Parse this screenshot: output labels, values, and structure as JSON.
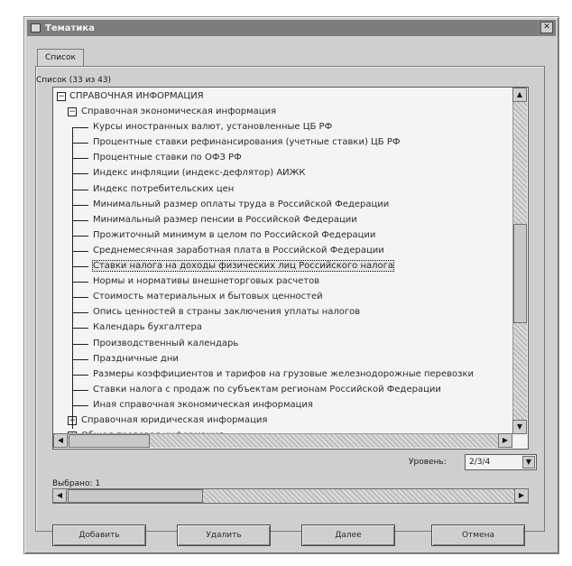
{
  "window": {
    "title": "Тематика",
    "close_glyph": "✕"
  },
  "tab": {
    "label": "Список"
  },
  "tree": {
    "group_label": "Список (33 из 43)",
    "root": {
      "label": "СПРАВОЧНАЯ ИНФОРМАЦИЯ",
      "toggle": "−"
    },
    "child": {
      "label": "Справочная экономическая информация",
      "toggle": "−"
    },
    "items": [
      "Курсы иностранных валют, установленные ЦБ РФ",
      "Процентные ставки рефинансирования (учетные ставки) ЦБ РФ",
      "Процентные ставки по ОФЗ РФ",
      "Индекс инфляции (индекс-дефлятор) АИЖК",
      "Индекс потребительских цен",
      "Минимальный размер оплаты труда в Российской Федерации",
      "Минимальный размер пенсии в Российской Федерации",
      "Прожиточный минимум в целом по Российской Федерации",
      "Среднемесячная заработная плата в Российской Федерации",
      "Ставки налога на доходы физических лиц Российского налога",
      "Нормы и нормативы внешнеторговых расчетов",
      "Стоимость материальных и бытовых ценностей",
      "Опись ценностей в страны заключения уплаты налогов",
      "Календарь бухгалтера",
      "Производственный календарь",
      "Праздничные дни",
      "Размеры коэффициентов и тарифов на грузовые железнодорожные перевозки",
      "Ставки налога с продаж по субъектам регионам Российской Федерации",
      "Иная справочная экономическая информация"
    ],
    "selected_index": 9,
    "after": [
      {
        "label": "Справочная юридическая информация",
        "toggle": "+"
      },
      {
        "label": "Общая правовая информация",
        "toggle": "+"
      }
    ]
  },
  "level": {
    "label": "Уровень:",
    "value": "2/3/4",
    "arrow": "▼"
  },
  "selected": {
    "label": "Выбрано: 1"
  },
  "scroll_glyphs": {
    "up": "▲",
    "down": "▼",
    "left": "◀",
    "right": "▶"
  },
  "buttons": {
    "add": "Добавить",
    "delete": "Удалить",
    "clear": "Далее",
    "cancel": "Отмена"
  }
}
